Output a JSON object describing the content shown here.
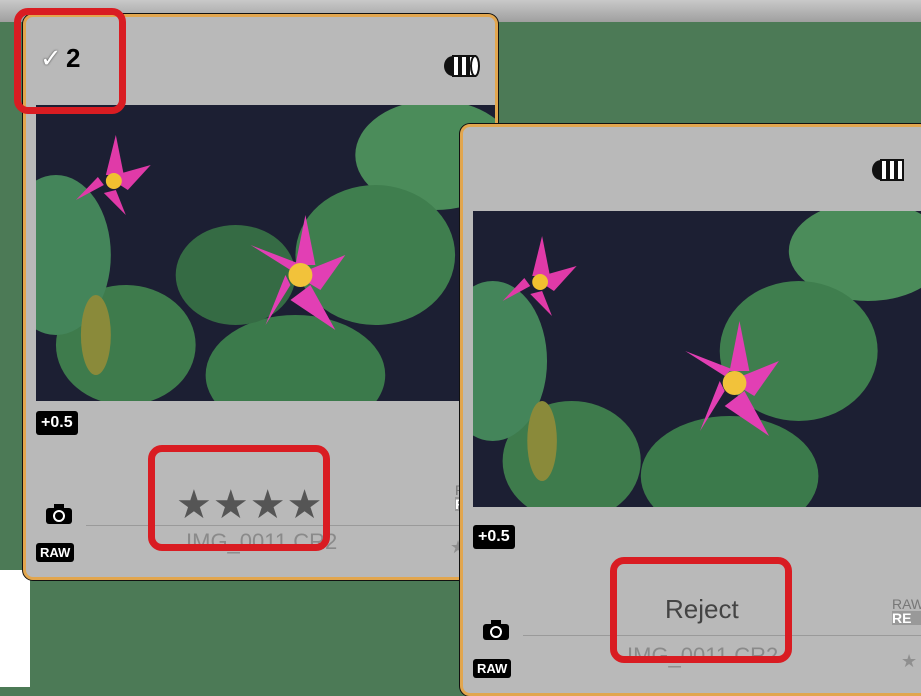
{
  "card1": {
    "check_count": "2",
    "exposure": "+0.5",
    "rating_stars": "★★★★",
    "format_badge": "RAW",
    "raw_label_top": "RA",
    "raw_label_bottom": "RE",
    "filename": "IMG_0011.CR2",
    "small_star": "★"
  },
  "card2": {
    "exposure": "+0.5",
    "rating_label": "Reject",
    "format_badge": "RAW",
    "raw_label_top": "RAW",
    "raw_label_bottom": "RE",
    "filename": "IMG_0011.CR2",
    "small_star": "★"
  },
  "colors": {
    "border": "#e2a64e",
    "highlight": "#d91c22",
    "background": "#4c7a56"
  }
}
